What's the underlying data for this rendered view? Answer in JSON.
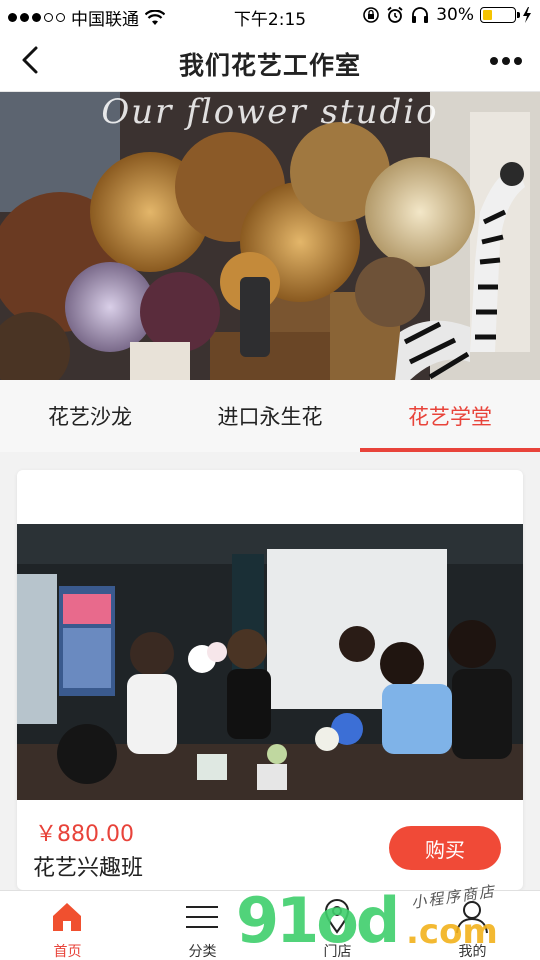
{
  "status_bar": {
    "carrier": "中国联通",
    "time": "下午2:15",
    "battery": "30%",
    "battery_level": 0.3
  },
  "nav": {
    "title": "我们花艺工作室"
  },
  "banner": {
    "script_text": "Our flower studio"
  },
  "tabs": [
    {
      "label": "花艺沙龙",
      "active": false
    },
    {
      "label": "进口永生花",
      "active": false
    },
    {
      "label": "花艺学堂",
      "active": true
    }
  ],
  "product": {
    "price": "￥880.00",
    "name": "花艺兴趣班",
    "buy_label": "购买"
  },
  "tabbar": {
    "items": [
      {
        "label": "首页",
        "icon": "home-icon",
        "active": true
      },
      {
        "label": "分类",
        "icon": "menu-icon",
        "active": false
      },
      {
        "label": "门店",
        "icon": "location-icon",
        "active": false
      },
      {
        "label": "我的",
        "icon": "user-icon",
        "active": false
      }
    ]
  },
  "watermark": {
    "main": "91od",
    "suffix": ".com",
    "script": "小程序商店"
  },
  "colors": {
    "accent": "#e8433a",
    "buy_button": "#f04a37"
  }
}
